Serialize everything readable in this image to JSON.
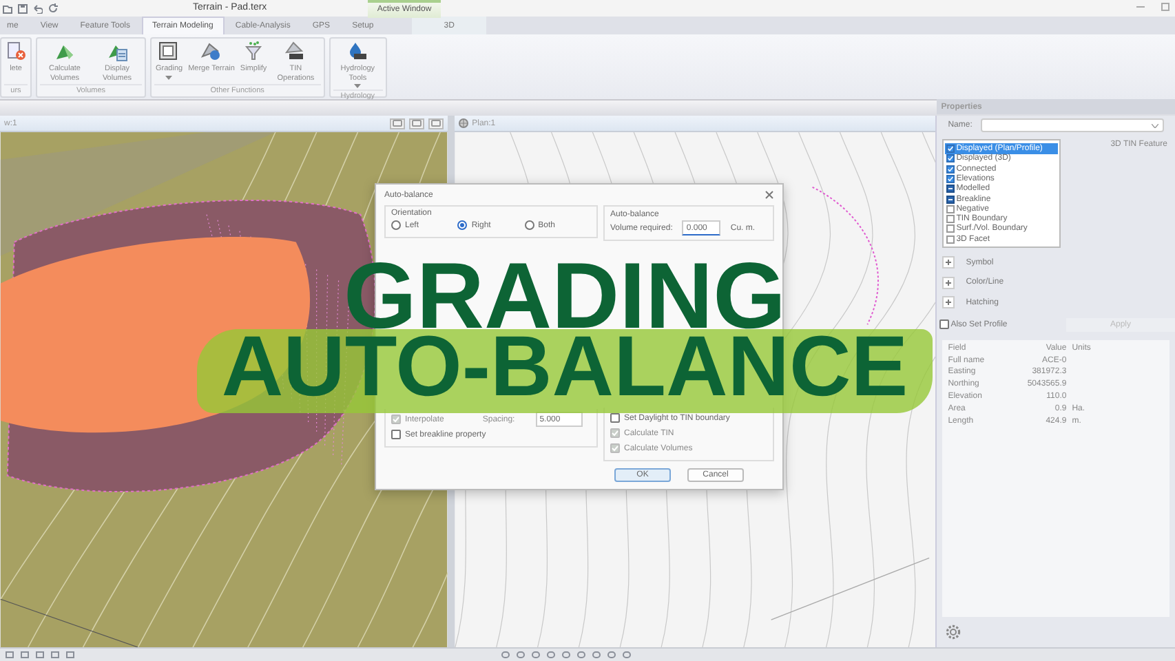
{
  "title_bar": {
    "title": "Terrain - Pad.terx",
    "context_tab": "Active Window"
  },
  "tabs": [
    {
      "label": "me",
      "selected": false,
      "kind": "main"
    },
    {
      "label": "View",
      "selected": false,
      "kind": "main"
    },
    {
      "label": "Feature Tools",
      "selected": false,
      "kind": "main"
    },
    {
      "label": "Terrain Modeling",
      "selected": true,
      "kind": "main"
    },
    {
      "label": "Cable-Analysis",
      "selected": false,
      "kind": "main"
    },
    {
      "label": "GPS",
      "selected": false,
      "kind": "main"
    },
    {
      "label": "Setup",
      "selected": false,
      "kind": "main"
    },
    {
      "label": "3D",
      "selected": false,
      "kind": "context"
    }
  ],
  "ribbon": {
    "groups": [
      {
        "label": "urs",
        "buttons": [
          {
            "label": "lete",
            "kind": "delete"
          }
        ]
      },
      {
        "label": "Volumes",
        "buttons": [
          {
            "label": "Calculate Volumes",
            "kind": "calc"
          },
          {
            "label": "Display Volumes",
            "kind": "display"
          }
        ]
      },
      {
        "label": "Other Functions",
        "buttons": [
          {
            "label": "Grading",
            "kind": "grading",
            "dropdown": true
          },
          {
            "label": "Merge Terrain",
            "kind": "merge"
          },
          {
            "label": "Simplify",
            "kind": "simplify"
          },
          {
            "label": "TIN Operations",
            "kind": "tin"
          }
        ]
      },
      {
        "label": "Hydrology",
        "buttons": [
          {
            "label": "Hydrology Tools",
            "kind": "hydrology",
            "dropdown": true
          }
        ]
      }
    ]
  },
  "panes": [
    {
      "title": "w:1",
      "kind": "terrain"
    },
    {
      "title": "Plan:1",
      "kind": "plan"
    }
  ],
  "dialog": {
    "title": "Auto-balance",
    "orientation": {
      "label": "Orientation",
      "options": [
        {
          "label": "Left",
          "selected": false
        },
        {
          "label": "Right",
          "selected": true
        },
        {
          "label": "Both",
          "selected": false
        }
      ]
    },
    "auto_balance": {
      "label": "Auto-balance",
      "volume_label": "Volume required:",
      "volume_value": "0.000",
      "volume_units": "Cu. m."
    },
    "left_options": [
      {
        "label": "Interpolate",
        "checked": true,
        "disabled": true
      },
      {
        "label": "Set breakline property",
        "checked": false,
        "disabled": false
      }
    ],
    "spacing": {
      "label": "Spacing:",
      "value": "5.000"
    },
    "right_options": [
      {
        "label": "Set Daylight to TIN boundary",
        "checked": false,
        "disabled": false
      },
      {
        "label": "Calculate TIN",
        "checked": true,
        "disabled": true
      },
      {
        "label": "Calculate Volumes",
        "checked": true,
        "disabled": true
      }
    ],
    "buttons": [
      {
        "label": "OK",
        "default": true
      },
      {
        "label": "Cancel",
        "default": false
      }
    ]
  },
  "overlay": {
    "lines": [
      "GRADING",
      "AUTO-BALANCE"
    ]
  },
  "properties": {
    "title": "Properties",
    "name_label": "Name:",
    "flags": [
      {
        "label": "Displayed (Plan/Profile)",
        "checked": true,
        "indeterminate": false,
        "selected": true
      },
      {
        "label": "Displayed (3D)",
        "checked": true,
        "indeterminate": false,
        "selected": false
      },
      {
        "label": "Connected",
        "checked": true,
        "indeterminate": false,
        "selected": false
      },
      {
        "label": "Elevations",
        "checked": true,
        "indeterminate": false,
        "selected": false
      },
      {
        "label": "Modelled",
        "checked": false,
        "indeterminate": true,
        "selected": false
      },
      {
        "label": "Breakline",
        "checked": false,
        "indeterminate": true,
        "selected": false
      },
      {
        "label": "Negative",
        "checked": false,
        "indeterminate": false,
        "selected": false
      },
      {
        "label": "TIN Boundary",
        "checked": false,
        "indeterminate": false,
        "selected": false
      },
      {
        "label": "Surf./Vol. Boundary",
        "checked": false,
        "indeterminate": false,
        "selected": false
      },
      {
        "label": "3D Facet",
        "checked": false,
        "indeterminate": false,
        "selected": false
      }
    ],
    "feature_type": "3D TIN Feature",
    "sections": [
      {
        "label": "Symbol",
        "expanded": false
      },
      {
        "label": "Color/Line",
        "expanded": false
      },
      {
        "label": "Hatching",
        "expanded": false
      }
    ],
    "also_set_profile": {
      "label": "Also Set Profile",
      "checked": false
    },
    "apply": {
      "label": "Apply",
      "disabled": true
    },
    "table": {
      "columns": [
        "Field",
        "Value",
        "Units"
      ],
      "rows": [
        {
          "field": "Full name",
          "value": "ACE-0"
        },
        {
          "field": "Easting",
          "value": "381972.3"
        },
        {
          "field": "Northing",
          "value": "5043565.9"
        },
        {
          "field": "Elevation",
          "value": "110.0"
        },
        {
          "field": "Area",
          "value": "0.9",
          "units": "Ha."
        },
        {
          "field": "Length",
          "value": "424.9",
          "units": "m."
        }
      ]
    }
  }
}
